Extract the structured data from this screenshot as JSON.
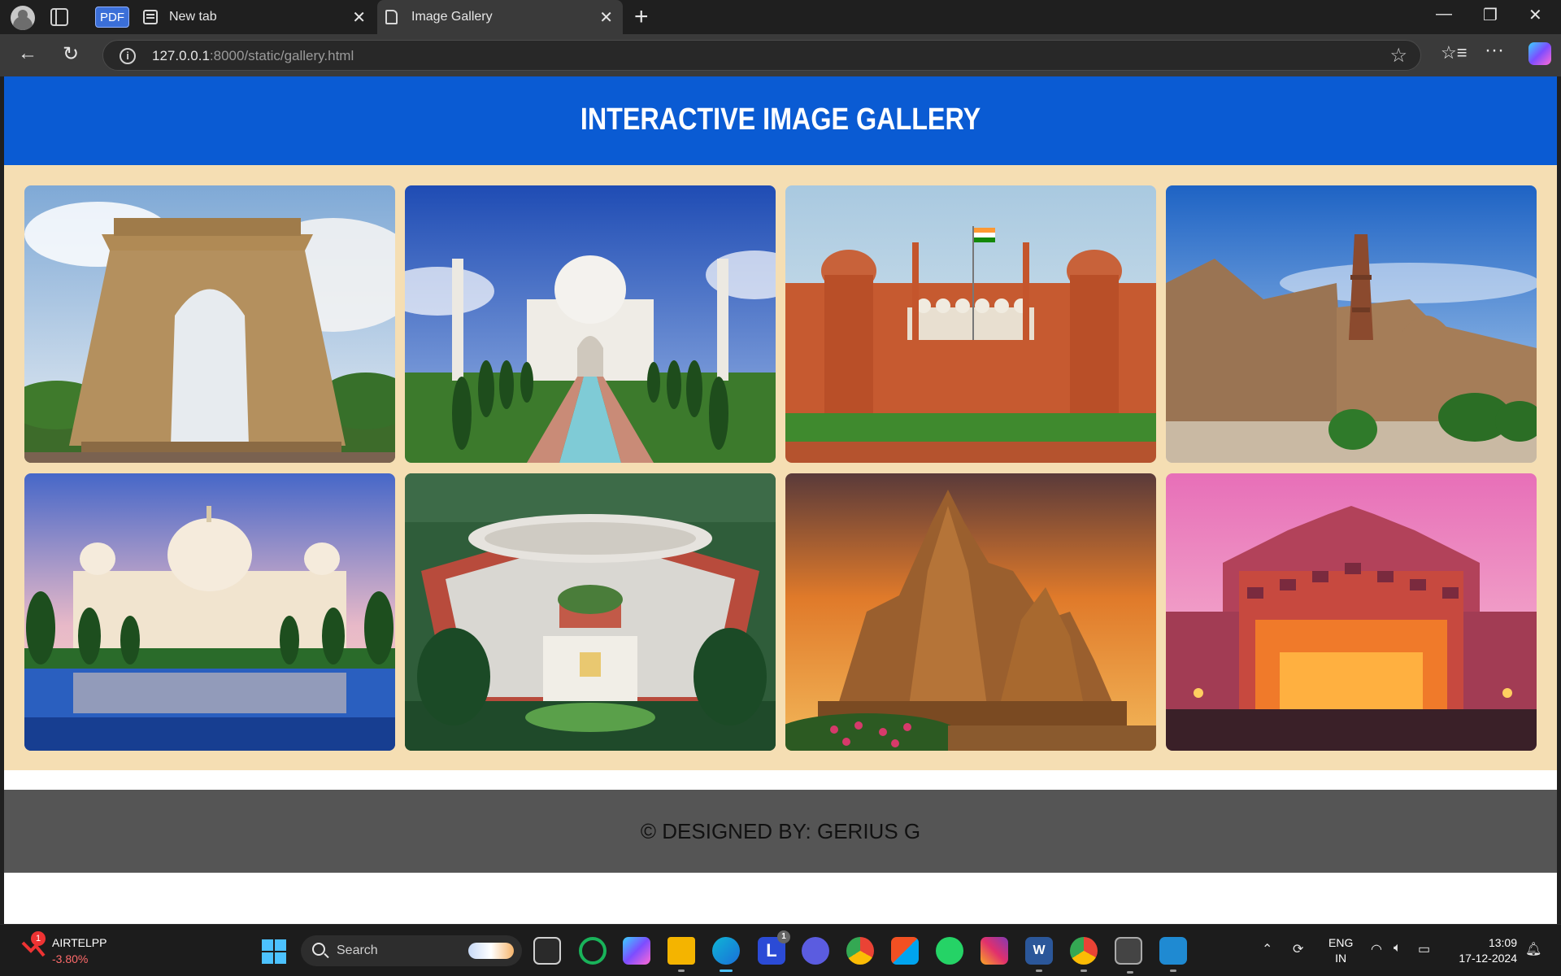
{
  "browser": {
    "pdf_badge": "PDF",
    "tabs": [
      {
        "title": "New tab"
      },
      {
        "title": "Image Gallery"
      }
    ],
    "url_host": "127.0.0.1",
    "url_rest": ":8000/static/gallery.html"
  },
  "page": {
    "title": "INTERACTIVE IMAGE GALLERY",
    "footer": "© DESIGNED BY: GERIUS G",
    "background_color": "#f5deb3",
    "header_color": "#0a5bd3",
    "footer_color": "#555555",
    "images": [
      {
        "subject": "india-gate"
      },
      {
        "subject": "taj-mahal"
      },
      {
        "subject": "red-fort"
      },
      {
        "subject": "qutub-minar"
      },
      {
        "subject": "victoria-memorial"
      },
      {
        "subject": "parliament-house"
      },
      {
        "subject": "khajuraho-temple"
      },
      {
        "subject": "hawa-mahal"
      }
    ]
  },
  "taskbar": {
    "stock_name": "AIRTELPP",
    "stock_change": "-3.80%",
    "stock_badge": "1",
    "search_placeholder": "Search",
    "language_line1": "ENG",
    "language_line2": "IN",
    "time": "13:09",
    "date": "17-12-2024",
    "l_badge": "1"
  }
}
